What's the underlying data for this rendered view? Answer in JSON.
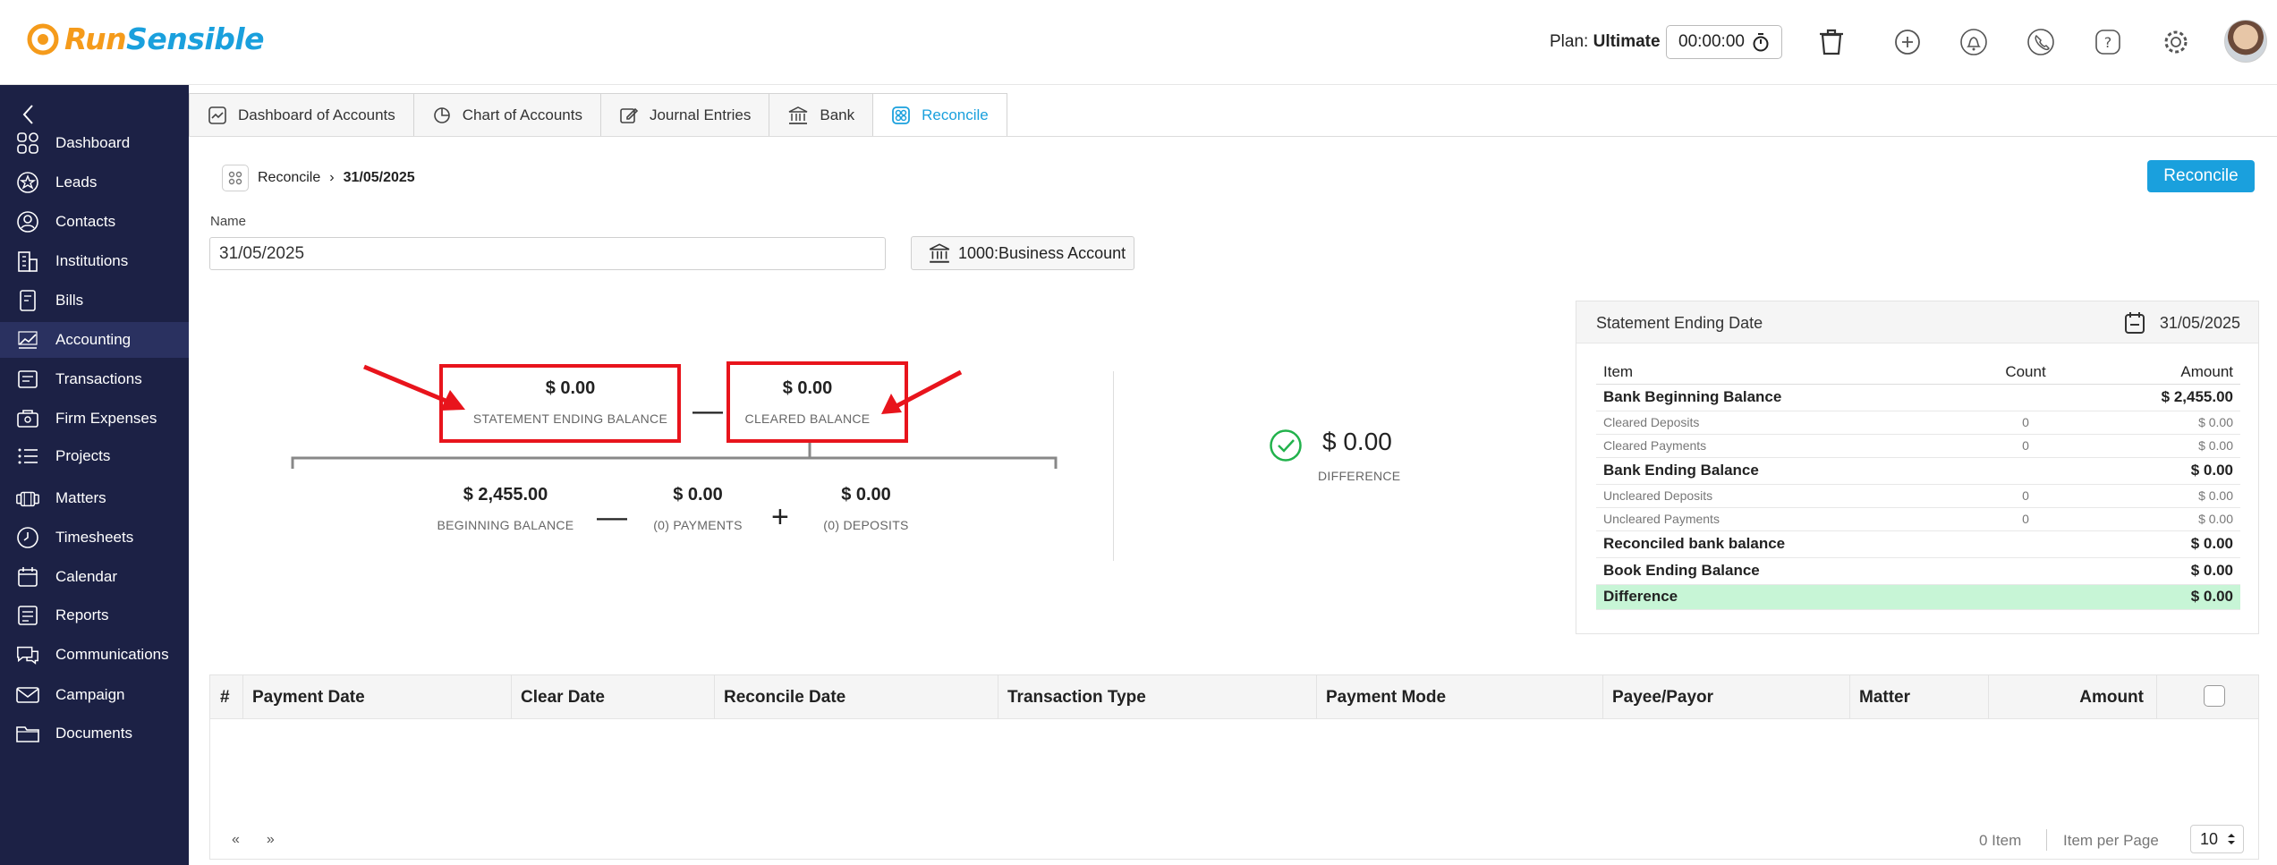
{
  "header": {
    "logo_part1": "Run",
    "logo_part2": "Sensible",
    "plan_label": "Plan:",
    "plan_value": "Ultimate",
    "timer": "00:00:00"
  },
  "sidebar": {
    "items": [
      {
        "label": "Dashboard",
        "icon": "grid-icon"
      },
      {
        "label": "Leads",
        "icon": "star-icon"
      },
      {
        "label": "Contacts",
        "icon": "user-icon"
      },
      {
        "label": "Institutions",
        "icon": "building-icon"
      },
      {
        "label": "Bills",
        "icon": "bill-icon"
      },
      {
        "label": "Accounting",
        "icon": "accounting-icon"
      },
      {
        "label": "Transactions",
        "icon": "transactions-icon"
      },
      {
        "label": "Firm Expenses",
        "icon": "expenses-icon"
      },
      {
        "label": "Projects",
        "icon": "list-icon"
      },
      {
        "label": "Matters",
        "icon": "matters-icon"
      },
      {
        "label": "Timesheets",
        "icon": "clock-icon"
      },
      {
        "label": "Calendar",
        "icon": "calendar-icon"
      },
      {
        "label": "Reports",
        "icon": "reports-icon"
      },
      {
        "label": "Communications",
        "icon": "chat-icon"
      },
      {
        "label": "Campaign",
        "icon": "mail-icon"
      },
      {
        "label": "Documents",
        "icon": "folder-icon"
      }
    ]
  },
  "tabs": [
    {
      "label": "Dashboard of Accounts"
    },
    {
      "label": "Chart of Accounts"
    },
    {
      "label": "Journal Entries"
    },
    {
      "label": "Bank"
    },
    {
      "label": "Reconcile"
    }
  ],
  "breadcrumb": {
    "root": "Reconcile",
    "current": "31/05/2025"
  },
  "reconcile_button": "Reconcile",
  "form": {
    "name_label": "Name",
    "name_value": "31/05/2025",
    "account": "1000:Business Account"
  },
  "balances": {
    "statement_ending": {
      "value": "$ 0.00",
      "label": "STATEMENT ENDING BALANCE"
    },
    "cleared": {
      "value": "$ 0.00",
      "label": "CLEARED BALANCE"
    },
    "beginning": {
      "value": "$ 2,455.00",
      "label": "BEGINNING BALANCE"
    },
    "payments": {
      "value": "$ 0.00",
      "label": "(0) PAYMENTS"
    },
    "deposits": {
      "value": "$ 0.00",
      "label": "(0) DEPOSITS"
    },
    "minus": "—",
    "plus": "+"
  },
  "difference": {
    "value": "$ 0.00",
    "label": "DIFFERENCE"
  },
  "summary": {
    "title": "Statement Ending Date",
    "date": "31/05/2025",
    "columns": [
      "Item",
      "Count",
      "Amount"
    ],
    "rows": [
      {
        "item": "Bank Beginning Balance",
        "count": "",
        "amount": "$ 2,455.00",
        "type": "major"
      },
      {
        "item": "Cleared Deposits",
        "count": "0",
        "amount": "$ 0.00",
        "type": "minor"
      },
      {
        "item": "Cleared Payments",
        "count": "0",
        "amount": "$ 0.00",
        "type": "minor"
      },
      {
        "item": "Bank Ending Balance",
        "count": "",
        "amount": "$ 0.00",
        "type": "major"
      },
      {
        "item": "Uncleared Deposits",
        "count": "0",
        "amount": "$ 0.00",
        "type": "minor"
      },
      {
        "item": "Uncleared Payments",
        "count": "0",
        "amount": "$ 0.00",
        "type": "minor"
      },
      {
        "item": "Reconciled bank balance",
        "count": "",
        "amount": "$ 0.00",
        "type": "major"
      },
      {
        "item": "Book Ending Balance",
        "count": "",
        "amount": "$ 0.00",
        "type": "major"
      },
      {
        "item": "Difference",
        "count": "",
        "amount": "$ 0.00",
        "type": "diff"
      }
    ]
  },
  "transactions": {
    "columns": [
      "#",
      "Payment Date",
      "Clear Date",
      "Reconcile Date",
      "Transaction Type",
      "Payment Mode",
      "Payee/Payor",
      "Matter",
      "Amount"
    ],
    "pager_prev": "«",
    "pager_next": "»",
    "items_count": "0 Item",
    "per_page_label": "Item per Page",
    "per_page_value": "10"
  },
  "colors": {
    "accent": "#1aa0dd",
    "sidebar": "#1c2145",
    "annotation": "#e8141c",
    "success": "#22b24c"
  }
}
